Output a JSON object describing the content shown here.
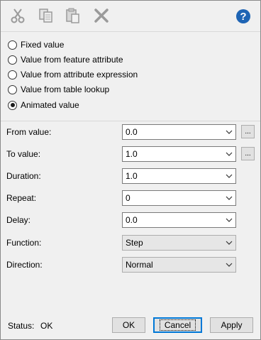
{
  "toolbar": {
    "cut_icon": "scissors-icon",
    "copy_icon": "copy-icon",
    "paste_icon": "paste-icon",
    "delete_icon": "delete-x-icon",
    "help_icon": "help-icon",
    "help_glyph": "?",
    "help_color": "#1e64b4"
  },
  "value_source": {
    "options": [
      {
        "label": "Fixed value",
        "checked": false
      },
      {
        "label": "Value from feature attribute",
        "checked": false
      },
      {
        "label": "Value from attribute expression",
        "checked": false
      },
      {
        "label": "Value from table lookup",
        "checked": false
      },
      {
        "label": "Animated value",
        "checked": true
      }
    ]
  },
  "form": {
    "from_value": {
      "label": "From value:",
      "value": "0.0",
      "button": "..."
    },
    "to_value": {
      "label": "To value:",
      "value": "1.0",
      "button": "..."
    },
    "duration": {
      "label": "Duration:",
      "value": "1.0"
    },
    "repeat": {
      "label": "Repeat:",
      "value": "0"
    },
    "delay": {
      "label": "Delay:",
      "value": "0.0"
    },
    "function": {
      "label": "Function:",
      "value": "Step"
    },
    "direction": {
      "label": "Direction:",
      "value": "Normal"
    }
  },
  "footer": {
    "status_label": "Status:",
    "status_value": "OK",
    "ok_label": "OK",
    "cancel_label": "Cancel",
    "apply_label": "Apply"
  },
  "colors": {
    "focus_accent": "#0078d7",
    "window_bg": "#f0f0f0"
  }
}
